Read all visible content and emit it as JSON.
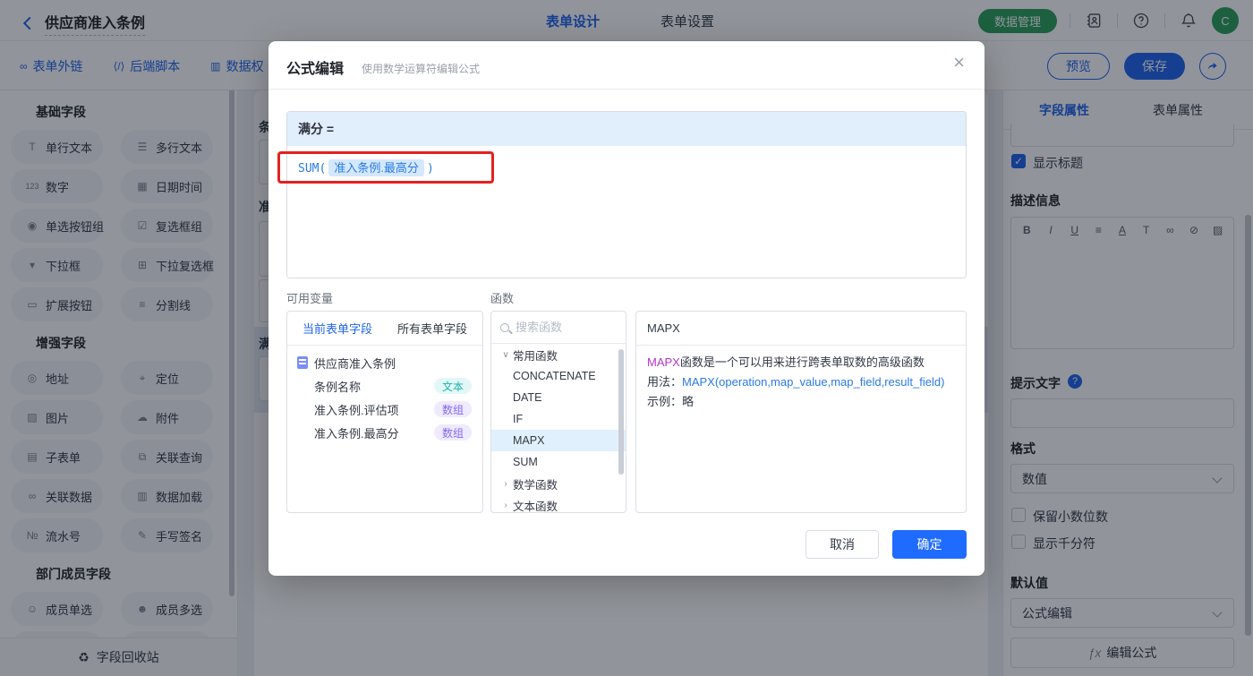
{
  "glyphs": {
    "check": "✓",
    "qmark": "?",
    "chev_open": "∨",
    "chev_closed": "›"
  },
  "topbar": {
    "title": "供应商准入条例",
    "tabs": [
      {
        "label": "表单设计"
      },
      {
        "label": "表单设置"
      }
    ],
    "data_manage": "数据管理",
    "avatar": "C"
  },
  "toolbar": {
    "links": [
      {
        "label": "表单外链",
        "glyph": "∞"
      },
      {
        "label": "后端脚本",
        "glyph": "⟨/⟩"
      },
      {
        "label": "数据权",
        "glyph": "▥"
      }
    ],
    "preview": "预览",
    "save": "保存"
  },
  "sidebar": {
    "sections": [
      {
        "title": "基础字段",
        "items": [
          {
            "label": "单行文本",
            "glyph": "T"
          },
          {
            "label": "多行文本",
            "glyph": "☰"
          },
          {
            "label": "数字",
            "glyph": "123"
          },
          {
            "label": "日期时间",
            "glyph": "▦"
          },
          {
            "label": "单选按钮组",
            "glyph": "◉"
          },
          {
            "label": "复选框组",
            "glyph": "☑"
          },
          {
            "label": "下拉框",
            "glyph": "▾"
          },
          {
            "label": "下拉复选框",
            "glyph": "⊞"
          },
          {
            "label": "扩展按钮",
            "glyph": "▭"
          },
          {
            "label": "分割线",
            "glyph": "≡"
          }
        ]
      },
      {
        "title": "增强字段",
        "items": [
          {
            "label": "地址",
            "glyph": "◎"
          },
          {
            "label": "定位",
            "glyph": "⌖"
          },
          {
            "label": "图片",
            "glyph": "▨"
          },
          {
            "label": "附件",
            "glyph": "☁"
          },
          {
            "label": "子表单",
            "glyph": "▤"
          },
          {
            "label": "关联查询",
            "glyph": "⧉"
          },
          {
            "label": "关联数据",
            "glyph": "∞"
          },
          {
            "label": "数据加载",
            "glyph": "▥"
          },
          {
            "label": "流水号",
            "glyph": "№"
          },
          {
            "label": "手写签名",
            "glyph": "✎"
          }
        ]
      },
      {
        "title": "部门成员字段",
        "items": [
          {
            "label": "成员单选",
            "glyph": "☺"
          },
          {
            "label": "成员多选",
            "glyph": "☻"
          }
        ]
      }
    ],
    "footer": {
      "label": "字段回收站",
      "glyph": "♻"
    }
  },
  "canvas": {
    "partial_labels": [
      "条",
      "准",
      "满"
    ]
  },
  "modal": {
    "title": "公式编辑",
    "subtitle": "使用数学运算符编辑公式",
    "close": "×",
    "formula_target": "满分 =",
    "formula_prefix": "SUM(",
    "formula_token": "准入条例.最高分",
    "formula_suffix": ")",
    "variables": {
      "label": "可用变量",
      "tabs": [
        {
          "label": "当前表单字段"
        },
        {
          "label": "所有表单字段"
        }
      ],
      "root": "供应商准入条例",
      "fields": [
        {
          "name": "条例名称",
          "badge": "文本"
        },
        {
          "name": "准入条例.评估项",
          "badge": "数组"
        },
        {
          "name": "准入条例.最高分",
          "badge": "数组"
        }
      ]
    },
    "functions": {
      "label": "函数",
      "search_placeholder": "搜索函数",
      "group_common": "常用函数",
      "items": [
        "CONCATENATE",
        "DATE",
        "IF",
        "MAPX",
        "SUM"
      ],
      "selected": "MAPX",
      "group_math": "数学函数",
      "group_text": "文本函数"
    },
    "detail": {
      "title": "MAPX",
      "desc_highlight": "MAPX",
      "desc_rest": "函数是一个可以用来进行跨表单取数的高级函数",
      "usage_label": "用法：",
      "usage_code": "MAPX(operation,map_value,map_field,result_field)",
      "example_label": "示例：",
      "example_value": "略"
    },
    "cancel": "取消",
    "confirm": "确定"
  },
  "rightpanel": {
    "tabs": [
      {
        "label": "字段属性"
      },
      {
        "label": "表单属性"
      }
    ],
    "show_title": "显示标题",
    "description": "描述信息",
    "richtext": [
      "B",
      "I",
      "U",
      "≡",
      "A",
      "T",
      "∞",
      "⊘",
      "▨"
    ],
    "hint": "提示文字",
    "format": "格式",
    "format_value": "数值",
    "keep_decimal": "保留小数位数",
    "thousand_sep": "显示千分符",
    "default_label": "默认值",
    "default_value": "公式编辑",
    "fx": "ƒx",
    "edit_formula": "编辑公式"
  },
  "colors": {
    "accent": "#2065ef",
    "confirm_blue": "#1f6bff",
    "green": "#2aa05c",
    "annotation_red": "#e52020",
    "badge_text_teal": "#19b5ad",
    "badge_array_purple": "#8468f5",
    "token_bg": "#d4e8fd",
    "selected_row": "#e1f0fd"
  }
}
